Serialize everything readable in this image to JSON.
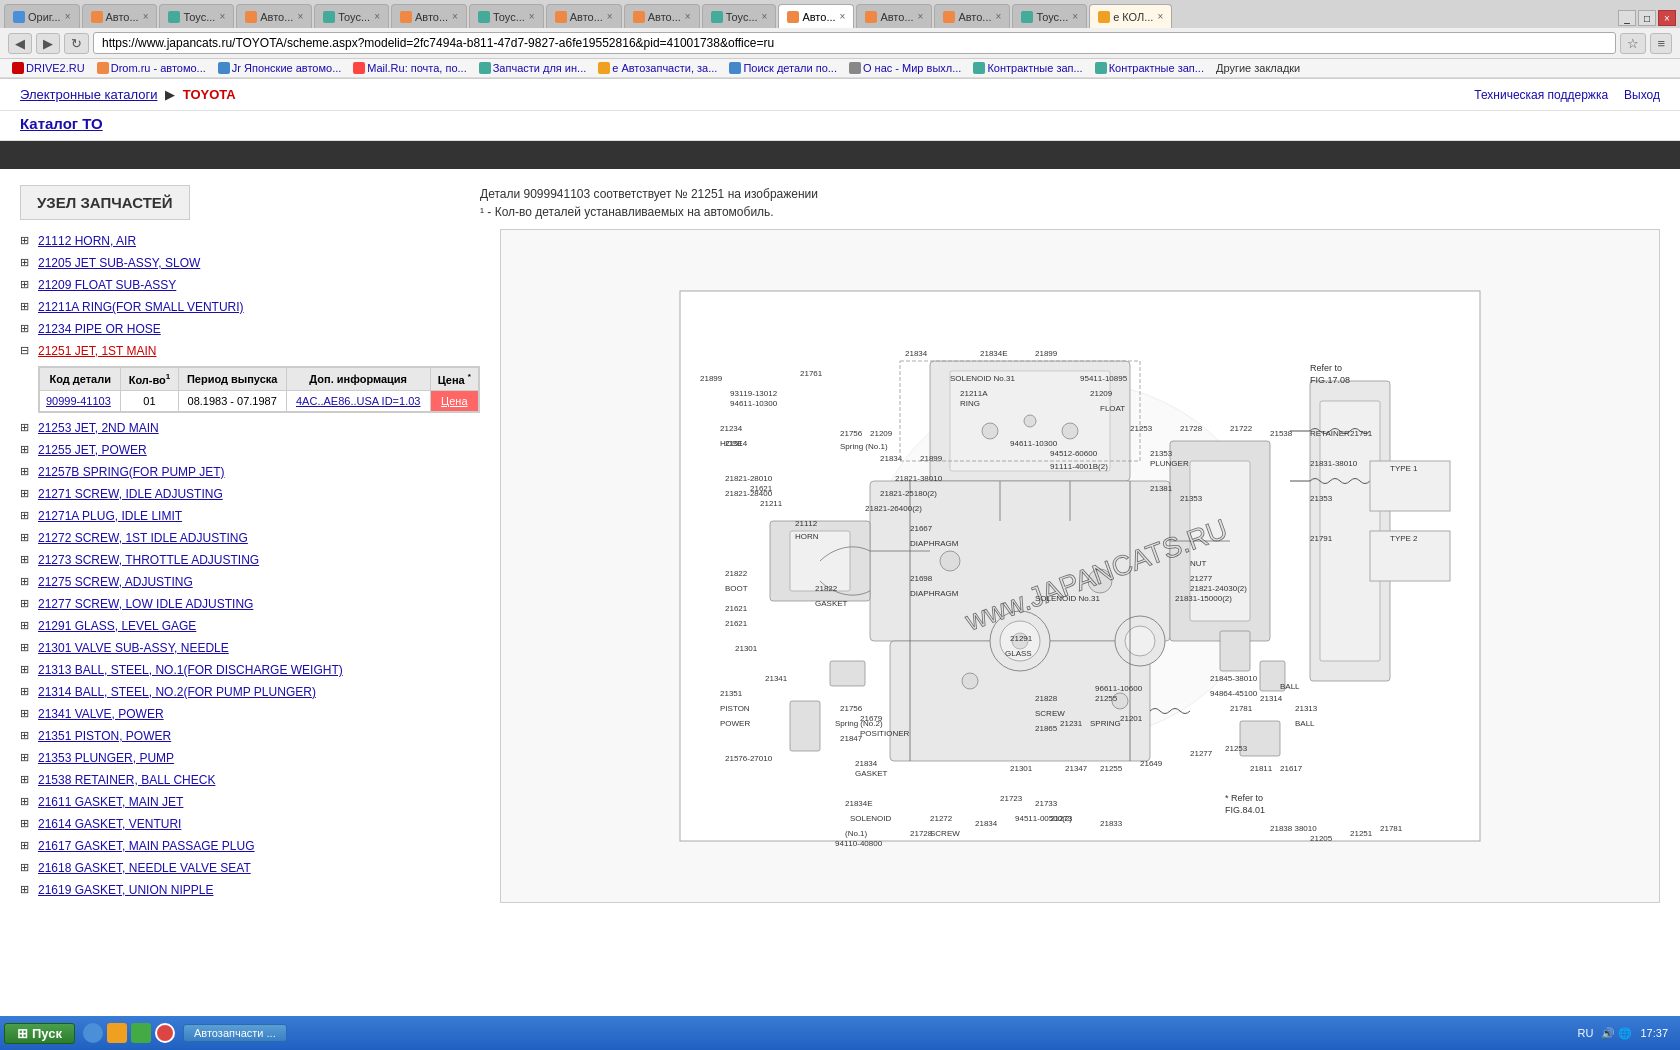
{
  "browser": {
    "tabs": [
      {
        "id": 1,
        "label": "Ориг...",
        "active": false,
        "color": "#e8f4ff"
      },
      {
        "id": 2,
        "label": "Авто...",
        "active": false
      },
      {
        "id": 3,
        "label": "Тоус...",
        "active": false
      },
      {
        "id": 4,
        "label": "Авто...",
        "active": false
      },
      {
        "id": 5,
        "label": "Тоус...",
        "active": false
      },
      {
        "id": 6,
        "label": "Авто...",
        "active": false
      },
      {
        "id": 7,
        "label": "Тоус...",
        "active": false
      },
      {
        "id": 8,
        "label": "Авто...",
        "active": false
      },
      {
        "id": 9,
        "label": "Авто...",
        "active": false
      },
      {
        "id": 10,
        "label": "Тоус...",
        "active": false
      },
      {
        "id": 11,
        "label": "Авто...",
        "active": true
      },
      {
        "id": 12,
        "label": "Авто...",
        "active": false
      },
      {
        "id": 13,
        "label": "Авто...",
        "active": false
      },
      {
        "id": 14,
        "label": "Тоус...",
        "active": false
      },
      {
        "id": 15,
        "label": "e КОЛ...",
        "active": false
      }
    ],
    "address": "https://www.japancats.ru/TOYOTA/scheme.aspx?modelid=2fc7494a-b811-47d7-9827-a6fe19552816&pid=41001738&office=ru",
    "bookmarks": [
      {
        "label": "DRIVE2.RU"
      },
      {
        "label": "Drom.ru - автомо..."
      },
      {
        "label": "Jr Японские автомо..."
      },
      {
        "label": "Mail.Ru: почта, по..."
      },
      {
        "label": "Запчасти для ин..."
      },
      {
        "label": "e Автозапчасти, за..."
      },
      {
        "label": "Поиск детали по..."
      },
      {
        "label": "О нас - Мир выхл..."
      },
      {
        "label": "Контрактные зап..."
      },
      {
        "label": "Контрактные зап..."
      },
      {
        "label": "Другие закладки"
      }
    ]
  },
  "site_header": {
    "breadcrumb_home": "Электронные каталоги",
    "breadcrumb_sep": "▶",
    "breadcrumb_current": "TOYOTA",
    "support_link": "Техническая поддержка",
    "exit_link": "Выход",
    "catalog_link": "Каталог ТО"
  },
  "page_title": "УЗЕЛ ЗАПЧАСТЕЙ",
  "info_message": {
    "line1": "Детали 9099941103 соответствует № 21251 на изображении",
    "line2": "¹ - Кол-во деталей устанавливаемых на автомобиль."
  },
  "parts_list": [
    {
      "code": "21112",
      "name": "HORN, AIR",
      "expanded": false,
      "active": false
    },
    {
      "code": "21205",
      "name": "JET SUB-ASSY, SLOW",
      "expanded": false,
      "active": false
    },
    {
      "code": "21209",
      "name": "FLOAT SUB-ASSY",
      "expanded": false,
      "active": false
    },
    {
      "code": "21211A",
      "name": "RING(FOR SMALL VENTURI)",
      "expanded": false,
      "active": false
    },
    {
      "code": "21234",
      "name": "PIPE OR HOSE",
      "expanded": false,
      "active": false
    },
    {
      "code": "21251",
      "name": "JET, 1ST MAIN",
      "expanded": true,
      "active": true
    },
    {
      "code": "21253",
      "name": "JET, 2ND MAIN",
      "expanded": false,
      "active": false
    },
    {
      "code": "21255",
      "name": "JET, POWER",
      "expanded": false,
      "active": false
    },
    {
      "code": "21257B",
      "name": "SPRING(FOR PUMP JET)",
      "expanded": false,
      "active": false
    },
    {
      "code": "21271",
      "name": "SCREW, IDLE ADJUSTING",
      "expanded": false,
      "active": false
    },
    {
      "code": "21271A",
      "name": "PLUG, IDLE LIMIT",
      "expanded": false,
      "active": false
    },
    {
      "code": "21272",
      "name": "SCREW, 1ST IDLE ADJUSTING",
      "expanded": false,
      "active": false
    },
    {
      "code": "21273",
      "name": "SCREW, THROTTLE ADJUSTING",
      "expanded": false,
      "active": false
    },
    {
      "code": "21275",
      "name": "SCREW, ADJUSTING",
      "expanded": false,
      "active": false
    },
    {
      "code": "21277",
      "name": "SCREW, LOW IDLE ADJUSTING",
      "expanded": false,
      "active": false
    },
    {
      "code": "21291",
      "name": "GLASS, LEVEL GAGE",
      "expanded": false,
      "active": false
    },
    {
      "code": "21301",
      "name": "VALVE SUB-ASSY, NEEDLE",
      "expanded": false,
      "active": false
    },
    {
      "code": "21313",
      "name": "BALL, STEEL, NO.1(FOR DISCHARGE WEIGHT)",
      "expanded": false,
      "active": false
    },
    {
      "code": "21314",
      "name": "BALL, STEEL, NO.2(FOR PUMP PLUNGER)",
      "expanded": false,
      "active": false
    },
    {
      "code": "21341",
      "name": "VALVE, POWER",
      "expanded": false,
      "active": false
    },
    {
      "code": "21351",
      "name": "PISTON, POWER",
      "expanded": false,
      "active": false
    },
    {
      "code": "21353",
      "name": "PLUNGER, PUMP",
      "expanded": false,
      "active": false
    },
    {
      "code": "21538",
      "name": "RETAINER, BALL CHECK",
      "expanded": false,
      "active": false
    },
    {
      "code": "21611",
      "name": "GASKET, MAIN JET",
      "expanded": false,
      "active": false
    },
    {
      "code": "21614",
      "name": "GASKET, VENTURI",
      "expanded": false,
      "active": false
    },
    {
      "code": "21617",
      "name": "GASKET, MAIN PASSAGE PLUG",
      "expanded": false,
      "active": false
    },
    {
      "code": "21618",
      "name": "GASKET, NEEDLE VALVE SEAT",
      "expanded": false,
      "active": false
    },
    {
      "code": "21619",
      "name": "GASKET, UNION NIPPLE",
      "expanded": false,
      "active": false
    }
  ],
  "detail_table": {
    "headers": [
      "Код детали",
      "Кол-во¹",
      "Период выпуска",
      "Доп. информация",
      "Цена *"
    ],
    "rows": [
      {
        "code": "90999-41103",
        "qty": "01",
        "period": "08.1983 - 07.1987",
        "info": "4AC..AE86..USA ID=1.03",
        "price": "Цена"
      }
    ]
  },
  "taskbar": {
    "start_label": "Пуск",
    "items": [
      "Автозапчасти ..."
    ],
    "time": "17:37",
    "lang": "RU"
  }
}
